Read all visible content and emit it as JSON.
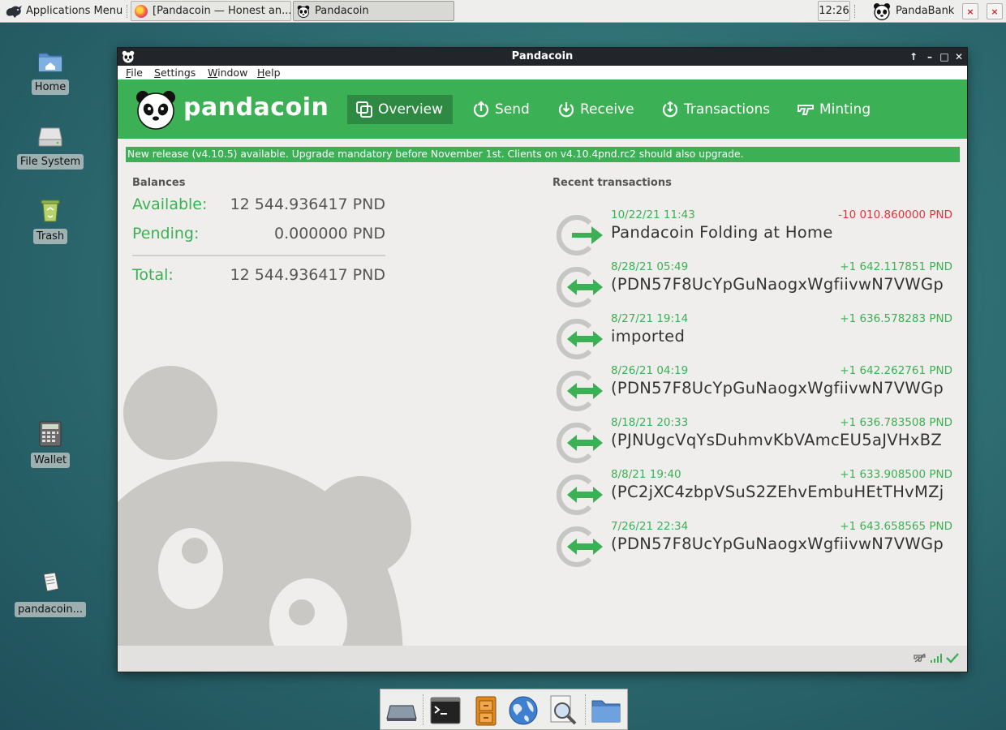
{
  "top_panel": {
    "apps_menu_label": "Applications Menu",
    "tasks": [
      {
        "label": "[Pandacoin — Honest an..."
      },
      {
        "label": "Pandacoin"
      }
    ],
    "clock": "12:26",
    "tray_label": "PandaBank",
    "close_glyph": "×"
  },
  "desktop": {
    "icons": [
      {
        "label": "Home",
        "icon": "home-folder-icon"
      },
      {
        "label": "File System",
        "icon": "drive-icon"
      },
      {
        "label": "Trash",
        "icon": "trash-icon"
      },
      {
        "label": "Wallet",
        "icon": "calculator-icon"
      },
      {
        "label": "pandacoin...",
        "icon": "file-icon"
      }
    ]
  },
  "window": {
    "title": "Pandacoin",
    "buttons": {
      "up": "↑",
      "min": "–",
      "max": "□",
      "close": "✕"
    },
    "menu": [
      "File",
      "Settings",
      "Window",
      "Help"
    ],
    "brand": "pandacoin",
    "tabs": [
      {
        "label": "Overview",
        "icon": "overview-icon",
        "active": true
      },
      {
        "label": "Send",
        "icon": "send-icon"
      },
      {
        "label": "Receive",
        "icon": "receive-icon"
      },
      {
        "label": "Transactions",
        "icon": "transactions-icon"
      },
      {
        "label": "Minting",
        "icon": "minting-icon"
      }
    ],
    "notice": "New release (v4.10.5) available. Upgrade mandatory before November 1st. Clients on v4.10.4pnd.rc2 should also upgrade.",
    "balances": {
      "title": "Balances",
      "available_label": "Available:",
      "available_value": "12 544.936417 PND",
      "pending_label": "Pending:",
      "pending_value": "0.000000 PND",
      "total_label": "Total:",
      "total_value": "12 544.936417 PND"
    },
    "recent": {
      "title": "Recent transactions",
      "items": [
        {
          "date": "10/22/21 11:43",
          "amount": "-10 010.860000 PND",
          "desc": "Pandacoin Folding at Home",
          "kind": "sent"
        },
        {
          "date": "8/28/21 05:49",
          "amount": "+1 642.117851 PND",
          "desc": "(PDN57F8UcYpGuNaogxWgfiivwN7VWGp",
          "kind": "minted"
        },
        {
          "date": "8/27/21 19:14",
          "amount": "+1 636.578283 PND",
          "desc": "imported",
          "kind": "minted"
        },
        {
          "date": "8/26/21 04:19",
          "amount": "+1 642.262761 PND",
          "desc": "(PDN57F8UcYpGuNaogxWgfiivwN7VWGp",
          "kind": "minted"
        },
        {
          "date": "8/18/21 20:33",
          "amount": "+1 636.783508 PND",
          "desc": "(PJNUgcVqYsDuhmvKbVAmcEU5aJVHxBZ",
          "kind": "minted"
        },
        {
          "date": "8/8/21 19:40",
          "amount": "+1 633.908500 PND",
          "desc": "(PC2jXC4zbpVSuS2ZEhvEmbuHEtTHvMZj",
          "kind": "minted"
        },
        {
          "date": "7/26/21 22:34",
          "amount": "+1 643.658565 PND",
          "desc": "(PDN57F8UcYpGuNaogxWgfiivwN7VWGp",
          "kind": "minted"
        }
      ]
    },
    "status": {
      "icons": [
        "staking-icon",
        "signal-icon",
        "synced-check-icon"
      ]
    }
  },
  "colors": {
    "brand_green": "#3cb054",
    "negative_red": "#e2343c",
    "titlebar": "#22262b"
  },
  "dock": {
    "items": [
      "drive-icon",
      "terminal-icon",
      "file-cabinet-icon",
      "web-browser-icon",
      "search-icon",
      "folder-icon"
    ]
  }
}
